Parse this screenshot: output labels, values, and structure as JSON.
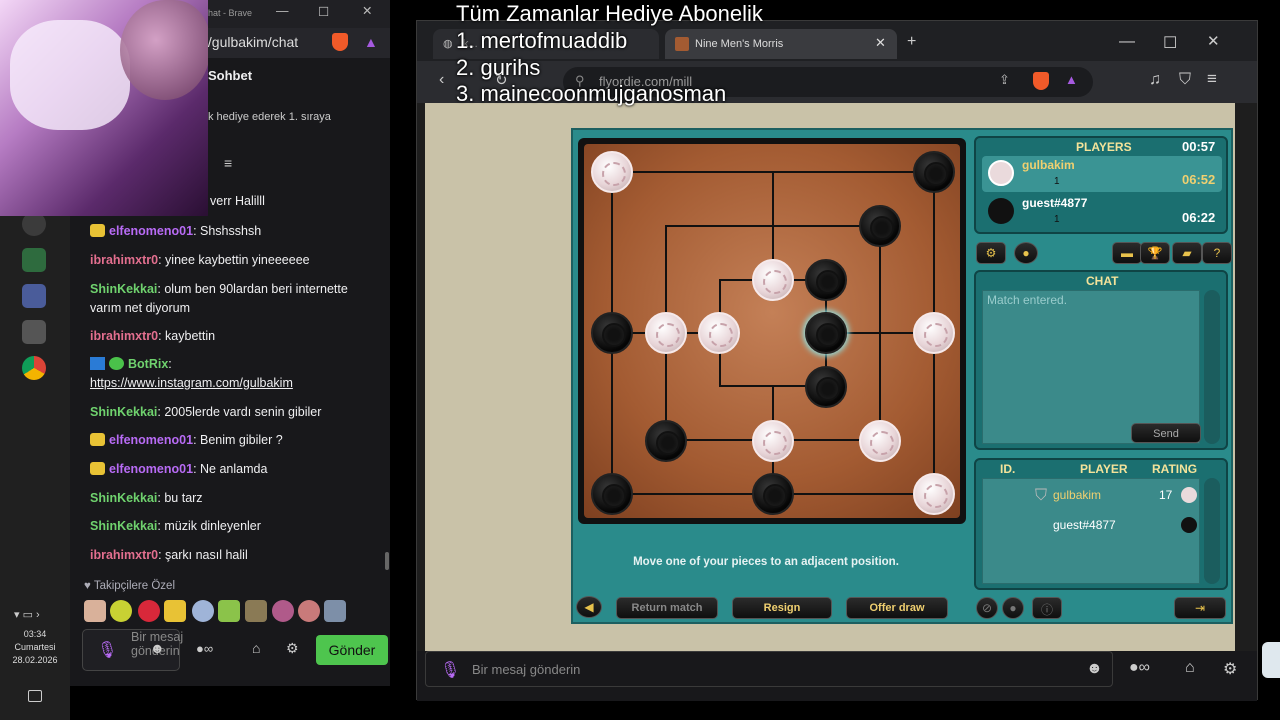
{
  "overlay": {
    "heading": "Tüm Zamanlar Hediye  Abonelik",
    "line1": "1. mertofmuaddib",
    "line2": "2. gurihs",
    "line3": "3. mainecoonmujganosman"
  },
  "chat_window": {
    "title": "hat - Brave",
    "address": "t/gulbakim/chat",
    "header": "Sohbet",
    "gift_banner": "k hediye ederek 1. sıraya",
    "partial_msg": "verr Halilll",
    "messages": [
      {
        "user": "elfenomeno01",
        "text": "Shshsshsh",
        "color": "purple",
        "badge": "pikachu"
      },
      {
        "user": "ibrahimxtr0",
        "text": "yinee kaybettin yineeeeee",
        "color": "pink"
      },
      {
        "user": "ShinKekkai",
        "text": "olum ben 90lardan beri internette varım net diyorum",
        "color": "green"
      },
      {
        "user": "ibrahimxtr0",
        "text": "kaybettin",
        "color": "pink"
      },
      {
        "user": "BotRix",
        "text": "https://www.instagram.com/gulbakim",
        "color": "green",
        "badge": "bot"
      },
      {
        "user": "ShinKekkai",
        "text": "2005lerde vardı senin gibiler",
        "color": "green"
      },
      {
        "user": "elfenomeno01",
        "text": "Benim gibiler ?",
        "color": "purple",
        "badge": "pikachu"
      },
      {
        "user": "elfenomeno01",
        "text": "Ne anlamda",
        "color": "purple",
        "badge": "pikachu"
      },
      {
        "user": "ShinKekkai",
        "text": "bu tarz",
        "color": "green"
      },
      {
        "user": "ShinKekkai",
        "text": "müzik dinleyenler",
        "color": "green"
      },
      {
        "user": "ibrahimxtr0",
        "text": "şarkı nasıl halil",
        "color": "pink"
      }
    ],
    "followers_label": "Takipçilere Özel",
    "input_placeholder": "Bir mesaj gönderin",
    "send_button": "Gönder"
  },
  "clock": {
    "time": "03:34",
    "day": "Cumartesi",
    "date": "28.02.2026"
  },
  "browser": {
    "tab1": "k...",
    "tab2": "Nine Men's Morris",
    "address": "flyordie.com/mill",
    "bottom_input_placeholder": "Bir mesaj gönderin"
  },
  "game": {
    "players_header": "PLAYERS",
    "timer": "00:57",
    "player1": {
      "name": "gulbakim",
      "score": "1",
      "time": "06:52"
    },
    "player2": {
      "name": "guest#4877",
      "score": "1",
      "time": "06:22"
    },
    "chat_header": "CHAT",
    "chat_text": "Match entered.",
    "send_label": "Send",
    "table_headers": [
      "ID.",
      "PLAYER",
      "RATING"
    ],
    "table_rows": [
      {
        "player": "gulbakim",
        "rating": "17"
      },
      {
        "player": "guest#4877",
        "rating": ""
      }
    ],
    "status_text": "Move one of your pieces to an adjacent position.",
    "return_match": "Return match",
    "resign": "Resign",
    "offer_draw": "Offer draw"
  }
}
